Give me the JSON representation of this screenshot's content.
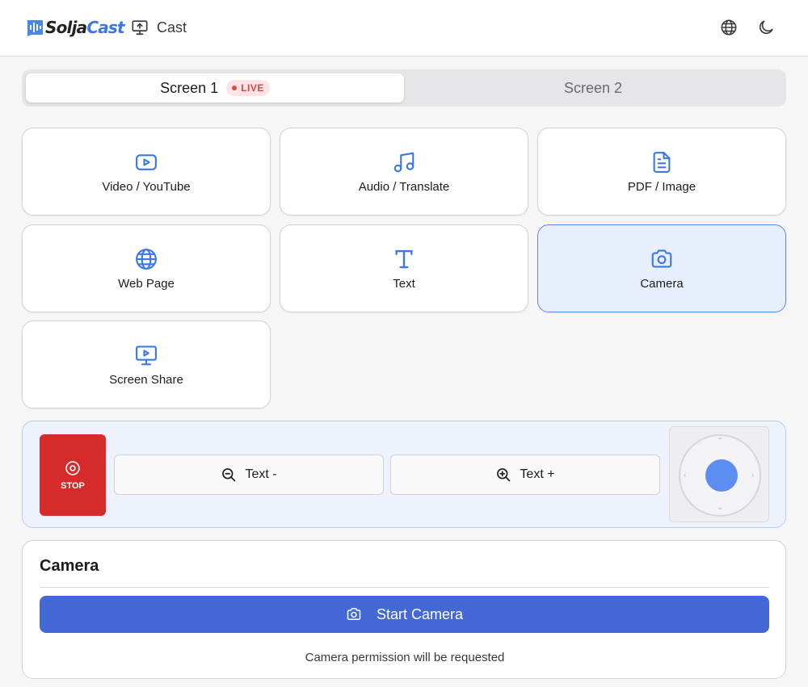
{
  "app": {
    "logo_part1": "Solja",
    "logo_part2": "Cast",
    "nav_label": "Cast"
  },
  "screens": [
    {
      "label": "Screen 1",
      "active": true,
      "badge": "LIVE"
    },
    {
      "label": "Screen 2",
      "active": false
    }
  ],
  "sources": [
    {
      "label": "Video / YouTube",
      "icon": "video-icon"
    },
    {
      "label": "Audio / Translate",
      "icon": "music-note-icon"
    },
    {
      "label": "PDF / Image",
      "icon": "document-icon"
    },
    {
      "label": "Web Page",
      "icon": "globe-icon"
    },
    {
      "label": "Text",
      "icon": "text-t-icon"
    },
    {
      "label": "Camera",
      "icon": "camera-icon",
      "selected": true
    },
    {
      "label": "Screen Share",
      "icon": "monitor-play-icon"
    }
  ],
  "controls": {
    "stop_label": "STOP",
    "text_minus": "Text -",
    "text_plus": "Text +"
  },
  "camera_panel": {
    "title": "Camera",
    "start_label": "Start Camera",
    "note": "Camera permission will be requested"
  },
  "colors": {
    "accent": "#3b78e7",
    "stop_red": "#d72a2a",
    "primary_button": "#4468d6",
    "live_text": "#d04a4a",
    "selected_tile_bg": "#e8effc"
  }
}
